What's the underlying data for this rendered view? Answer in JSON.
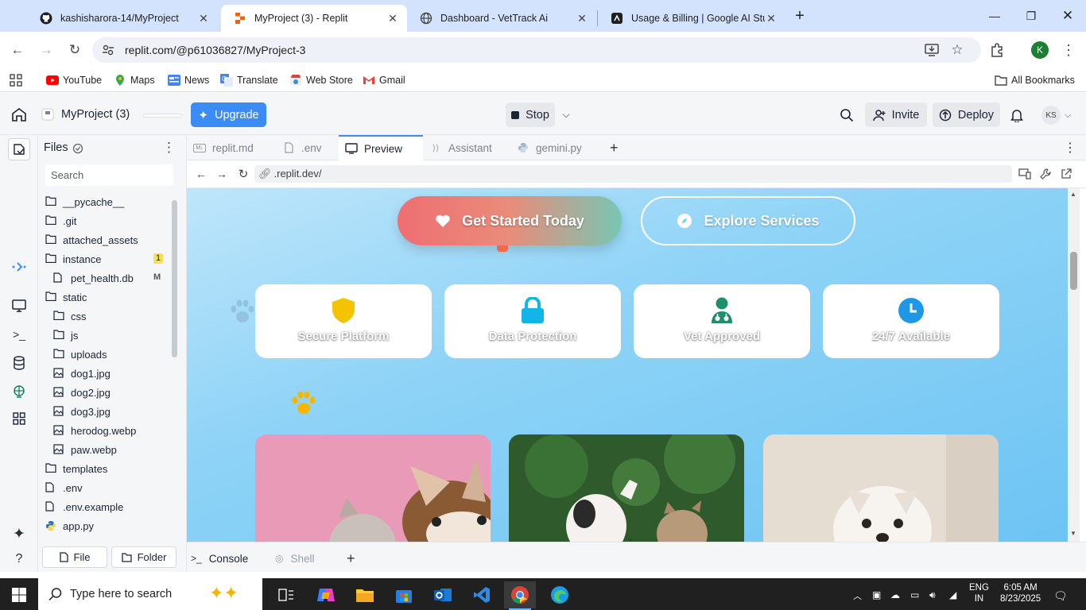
{
  "browser": {
    "tabs": [
      {
        "title": "kashisharora-14/MyProject",
        "icon": "github-icon",
        "active": false
      },
      {
        "title": "MyProject (3) - Replit",
        "icon": "replit-icon",
        "active": true
      },
      {
        "title": "Dashboard - VetTrack Ai",
        "icon": "globe-icon",
        "active": false
      },
      {
        "title": "Usage & Billing | Google AI Stu",
        "icon": "ai-studio-icon",
        "active": false
      }
    ],
    "url": "replit.com/@p61036827/MyProject-3",
    "profile_initial": "K",
    "bookmarks": [
      "YouTube",
      "Maps",
      "News",
      "Translate",
      "Web Store",
      "Gmail"
    ],
    "all_bookmarks": "All Bookmarks"
  },
  "replit": {
    "project_name": "MyProject (3)",
    "upgrade_label": "Upgrade",
    "stop_label": "Stop",
    "invite_label": "Invite",
    "deploy_label": "Deploy",
    "avatar_initials": "KS",
    "files_title": "Files",
    "search_placeholder": "Search",
    "file_tree": [
      {
        "name": "__pycache__",
        "type": "folder",
        "indent": 0
      },
      {
        "name": ".git",
        "type": "folder",
        "indent": 0
      },
      {
        "name": "attached_assets",
        "type": "folder",
        "indent": 0
      },
      {
        "name": "instance",
        "type": "folder",
        "indent": 0,
        "badge": "1"
      },
      {
        "name": "pet_health.db",
        "type": "file",
        "indent": 1,
        "badge": "M"
      },
      {
        "name": "static",
        "type": "folder",
        "indent": 0
      },
      {
        "name": "css",
        "type": "folder",
        "indent": 1
      },
      {
        "name": "js",
        "type": "folder",
        "indent": 1
      },
      {
        "name": "uploads",
        "type": "folder",
        "indent": 1
      },
      {
        "name": "dog1.jpg",
        "type": "image",
        "indent": 1
      },
      {
        "name": "dog2.jpg",
        "type": "image",
        "indent": 1
      },
      {
        "name": "dog3.jpg",
        "type": "image",
        "indent": 1
      },
      {
        "name": "herodog.webp",
        "type": "image",
        "indent": 1
      },
      {
        "name": "paw.webp",
        "type": "image",
        "indent": 1
      },
      {
        "name": "templates",
        "type": "folder",
        "indent": 0
      },
      {
        "name": ".env",
        "type": "file",
        "indent": 0
      },
      {
        "name": ".env.example",
        "type": "file",
        "indent": 0
      },
      {
        "name": "app.py",
        "type": "python",
        "indent": 0
      }
    ],
    "file_button": "File",
    "folder_button": "Folder",
    "editor_tabs": [
      {
        "label": "replit.md",
        "icon": "markdown-icon",
        "active": false
      },
      {
        "label": ".env",
        "icon": "file-icon",
        "active": false
      },
      {
        "label": "Preview",
        "icon": "preview-icon",
        "active": true
      },
      {
        "label": "Assistant",
        "icon": "assistant-icon",
        "active": false
      },
      {
        "label": "gemini.py",
        "icon": "python-icon",
        "active": false
      }
    ],
    "webview_url": ".replit.dev/",
    "console_tabs": [
      "Console",
      "Shell"
    ]
  },
  "preview": {
    "cta_primary": "Get Started Today",
    "cta_secondary": "Explore Services",
    "features": [
      {
        "label": "Secure Platform",
        "icon": "shield-icon",
        "color": "#f5c400"
      },
      {
        "label": "Data Protection",
        "icon": "lock-icon",
        "color": "#12b5e8"
      },
      {
        "label": "Vet Approved",
        "icon": "doctor-icon",
        "color": "#1f8f6a"
      },
      {
        "label": "24/7 Available",
        "icon": "clock-icon",
        "color": "#1c98e6"
      }
    ],
    "photos": [
      "dog-and-cat-photo",
      "puppy-and-kitten-photo",
      "terrier-photo"
    ]
  },
  "taskbar": {
    "search_placeholder": "Type here to search",
    "language": "ENG",
    "region": "IN",
    "time": "6:05 AM",
    "date": "8/23/2025"
  },
  "colors": {
    "accent": "#3b8cf5",
    "chrome_tabstrip": "#d3e3fd",
    "preview_bg": "#8fd3f7"
  }
}
